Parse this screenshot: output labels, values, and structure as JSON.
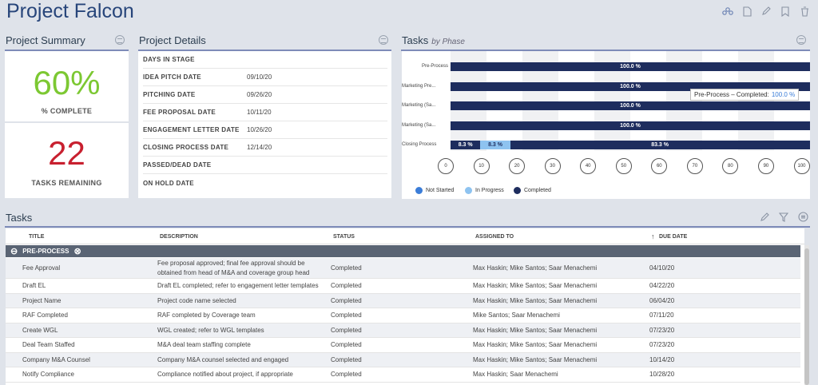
{
  "header": {
    "title": "Project Falcon"
  },
  "summary": {
    "title": "Project Summary",
    "pct": "60%",
    "pct_label": "% COMPLETE",
    "remaining": "22",
    "remaining_label": "TASKS REMAINING"
  },
  "details": {
    "title": "Project Details",
    "rows": [
      {
        "label": "DAYS IN STAGE",
        "value": ""
      },
      {
        "label": "IDEA PITCH DATE",
        "value": "09/10/20"
      },
      {
        "label": "PITCHING DATE",
        "value": "09/26/20"
      },
      {
        "label": "FEE PROPOSAL DATE",
        "value": "10/11/20"
      },
      {
        "label": "ENGAGEMENT LETTER DATE",
        "value": "10/26/20"
      },
      {
        "label": "CLOSING PROCESS DATE",
        "value": "12/14/20"
      },
      {
        "label": "PASSED/DEAD DATE",
        "value": ""
      },
      {
        "label": "ON HOLD DATE",
        "value": ""
      }
    ]
  },
  "tasks_chart": {
    "title": "Tasks",
    "subtitle": "by Phase"
  },
  "chart_data": {
    "type": "bar",
    "orientation": "horizontal-stacked",
    "categories": [
      "Pre-Process",
      "Marketing Pre...",
      "Marketing (Sa...",
      "Marketing (Sa...",
      "Closing Process"
    ],
    "series": [
      {
        "name": "Not Started",
        "color": "#3b7dd8",
        "values": [
          0,
          0,
          0,
          0,
          8.3
        ],
        "labels": [
          "",
          "",
          "",
          "",
          "8.3 %"
        ]
      },
      {
        "name": "In Progress",
        "color": "#8ec3f0",
        "values": [
          0,
          0,
          0,
          0,
          8.3
        ],
        "labels": [
          "",
          "",
          "",
          "",
          "8.3 %"
        ]
      },
      {
        "name": "Completed",
        "color": "#1e2d5e",
        "values": [
          100,
          100,
          100,
          100,
          83.3
        ],
        "labels": [
          "100.0 %",
          "100.0 %",
          "100.0 %",
          "100.0 %",
          "83.3 %"
        ]
      }
    ],
    "xticks": [
      "0",
      "10",
      "20",
      "30",
      "40",
      "50",
      "60",
      "70",
      "80",
      "90",
      "100"
    ],
    "xlim": [
      0,
      100
    ],
    "legend": "bottom-left",
    "tooltip": {
      "text": "Pre-Process – Completed:",
      "value": "100.0 %"
    }
  },
  "tasks_table": {
    "title": "Tasks",
    "columns": {
      "title": "TITLE",
      "description": "DESCRIPTION",
      "status": "STATUS",
      "assigned": "ASSIGNED TO",
      "due": "DUE DATE"
    },
    "sort_icon": "↑",
    "group": {
      "label": "PRE-PROCESS",
      "collapse_glyph": "⊖",
      "clear_glyph": "⊗"
    },
    "rows": [
      {
        "title": "Fee Approval",
        "desc1": "Fee proposal approved; final fee approval should be",
        "desc2": "obtained from head of M&A and coverage group head",
        "status": "Completed",
        "assigned": "Max Haskin; Mike Santos; Saar Menachemi",
        "due": "04/10/20"
      },
      {
        "title": "Draft EL",
        "desc1": "Draft EL completed; refer to engagement letter templates",
        "desc2": "",
        "status": "Completed",
        "assigned": "Max Haskin; Mike Santos; Saar Menachemi",
        "due": "04/22/20"
      },
      {
        "title": "Project Name",
        "desc1": "Project code name selected",
        "desc2": "",
        "status": "Completed",
        "assigned": "Max Haskin; Mike Santos; Saar Menachemi",
        "due": "06/04/20"
      },
      {
        "title": "RAF Completed",
        "desc1": "RAF completed by Coverage team",
        "desc2": "",
        "status": "Completed",
        "assigned": "Mike Santos; Saar Menachemi",
        "due": "07/11/20"
      },
      {
        "title": "Create WGL",
        "desc1": "WGL created; refer to WGL templates",
        "desc2": "",
        "status": "Completed",
        "assigned": "Max Haskin; Mike Santos; Saar Menachemi",
        "due": "07/23/20"
      },
      {
        "title": "Deal Team Staffed",
        "desc1": "M&A deal team staffing complete",
        "desc2": "",
        "status": "Completed",
        "assigned": "Max Haskin; Mike Santos; Saar Menachemi",
        "due": "07/23/20"
      },
      {
        "title": "Company M&A Counsel",
        "desc1": "Company M&A counsel selected and engaged",
        "desc2": "",
        "status": "Completed",
        "assigned": "Max Haskin; Mike Santos; Saar Menachemi",
        "due": "10/14/20"
      },
      {
        "title": "Notify Compliance",
        "desc1": "Compliance notified about project, if appropriate",
        "desc2": "",
        "status": "Completed",
        "assigned": "Max Haskin; Saar Menachemi",
        "due": "10/28/20"
      }
    ]
  },
  "icons": {
    "header": [
      "share-icon",
      "document-icon",
      "pencil-icon",
      "bookmark-icon",
      "trash-icon"
    ],
    "tasks": [
      "pencil-icon",
      "filter-icon",
      "menu-icon"
    ]
  }
}
